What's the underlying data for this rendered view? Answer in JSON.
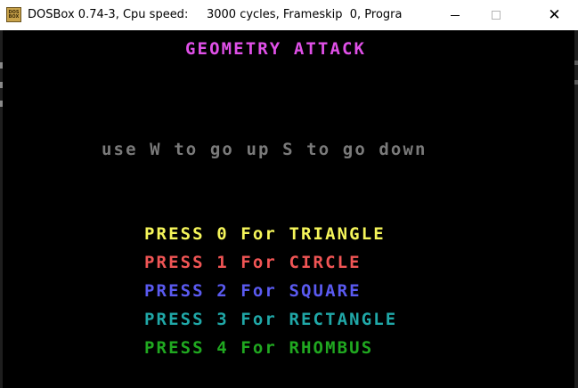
{
  "window": {
    "title": "DOSBox 0.74-3, Cpu speed:     3000 cycles, Frameskip  0, Progra",
    "icon_label": "DOS BOX",
    "icon": "dosbox-icon",
    "controls": {
      "minimize": "minimize-icon",
      "maximize": "maximize-icon",
      "close": "close-icon"
    }
  },
  "game": {
    "title": "GEOMETRY ATTACK",
    "title_color": "#e050e8",
    "instructions": "use W to go up S to go down",
    "instructions_color": "#7a7a7a",
    "menu": [
      {
        "text": "PRESS 0 For TRIANGLE",
        "color": "#f5f55a"
      },
      {
        "text": "PRESS 1 For CIRCLE",
        "color": "#f05555"
      },
      {
        "text": "PRESS 2 For SQUARE",
        "color": "#5a5af0"
      },
      {
        "text": "PRESS 3 For RECTANGLE",
        "color": "#20a8a8"
      },
      {
        "text": "PRESS 4 For RHOMBUS",
        "color": "#20a820"
      }
    ]
  },
  "colors": {
    "screen_bg": "#000000",
    "titlebar_bg": "#ffffff"
  }
}
